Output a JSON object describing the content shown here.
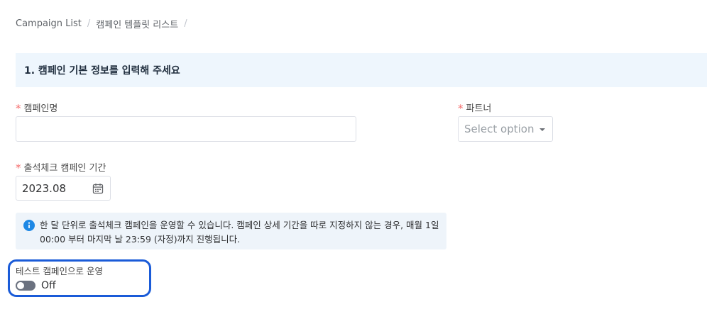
{
  "breadcrumb": {
    "items": [
      "Campaign List",
      "캠페인 템플릿 리스트"
    ],
    "separator": "/"
  },
  "section": {
    "title": "1. 캠페인 기본 정보를 입력해 주세요"
  },
  "form": {
    "required_mark": "*",
    "campaign_name": {
      "label": "캠페인명",
      "value": ""
    },
    "partner": {
      "label": "파트너",
      "placeholder": "Select option"
    },
    "period": {
      "label": "출석체크 캠페인 기간",
      "value": "2023.08"
    },
    "info": {
      "text": "한 달 단위로 출석체크 캠페인을 운영할 수 있습니다. 캠페인 상세 기간을 따로 지정하지 않는 경우, 매월 1일 00:00 부터 마지막 날 23:59 (자정)까지 진행됩니다."
    },
    "test_campaign": {
      "label": "테스트 캠페인으로 운영",
      "state": "Off"
    }
  },
  "colors": {
    "accent": "#1a5bd8",
    "required": "#f56c6c",
    "section_bg": "#eef6fd",
    "info_bg": "#eef4fa",
    "info_icon": "#1e88e5",
    "toggle_off": "#6b7280"
  },
  "icons": {
    "calendar": "calendar-icon",
    "info": "info-icon",
    "caret": "chevron-down-icon"
  }
}
